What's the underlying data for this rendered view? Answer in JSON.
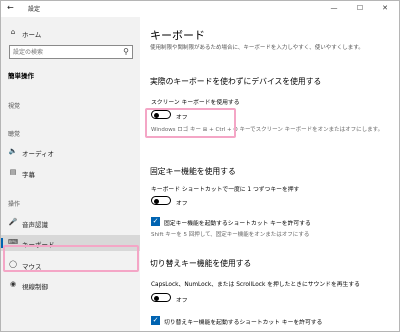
{
  "window": {
    "title": "設定",
    "back_icon": "back-arrow-icon",
    "controls": {
      "minimize": "—",
      "maximize": "☐",
      "close": "✕"
    }
  },
  "sidebar": {
    "home_label": "ホーム",
    "search_placeholder": "設定の検索",
    "section_title": "簡単操作",
    "groups": [
      {
        "label": "視覚"
      },
      {
        "label": "聴覚"
      },
      {
        "label": "操作"
      }
    ],
    "items": [
      {
        "label": "オーディオ",
        "icon": "speaker-icon"
      },
      {
        "label": "字幕",
        "icon": "caption-icon"
      },
      {
        "label": "音声認識",
        "icon": "microphone-icon"
      },
      {
        "label": "キーボード",
        "icon": "keyboard-icon",
        "selected": true
      },
      {
        "label": "マウス",
        "icon": "mouse-icon"
      },
      {
        "label": "視線制御",
        "icon": "eye-control-icon"
      }
    ]
  },
  "main": {
    "title": "キーボード",
    "description": "使用制限や聞制限があるため場合に、キーボードを入力しやすく、使いやすくします。",
    "section1": {
      "heading": "実際のキーボードを使わずにデバイスを使用する",
      "toggle_label": "スクリーン キーボードを使用する",
      "toggle_state": "オフ",
      "note": "Windows ロゴ キー ⊞ + Ctrl + O キーでスクリーン キーボードをオンまたはオフにします。"
    },
    "section2": {
      "heading": "固定キー機能を使用する",
      "toggle_label": "キーボード ショートカットで一度に 1 つずつキーを押す",
      "toggle_state": "オフ",
      "checkbox_label": "固定キー機能を起動するショートカット キーを許可する",
      "note": "Shift キーを 5 回押して、固定キー機能をオンまたはオフにする"
    },
    "section3": {
      "heading": "切り替えキー機能を使用する",
      "toggle_label": "CapsLock、NumLock、または ScrollLock を押したときにサウンドを再生する",
      "toggle_state": "オフ",
      "checkbox_label": "切り替えキー機能を起動するショートカット キーを許可する"
    }
  },
  "colors": {
    "accent": "#0063b1",
    "highlight": "#f4a6c6",
    "sidebar_bg": "#f2f2f2"
  }
}
